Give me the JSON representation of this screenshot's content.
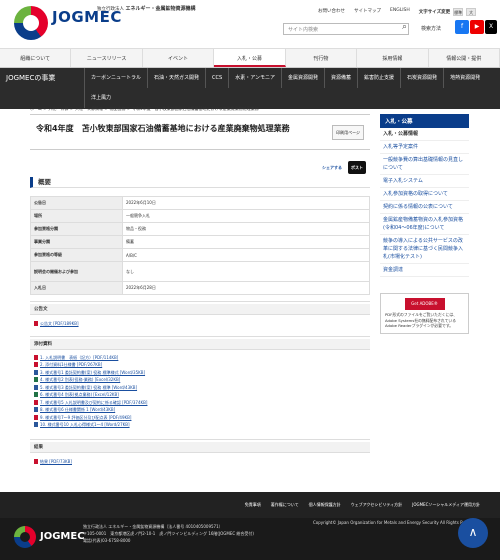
{
  "header": {
    "logo_text": "JOGMEC",
    "org_line1": "独立行政法人",
    "org_line2": "エネルギー・金属鉱物資源機構",
    "links": [
      "お問い合わせ",
      "サイトマップ",
      "ENGLISH"
    ],
    "fontsize_label": "文字サイズ変更",
    "fontsize_options": [
      "標準",
      "大"
    ],
    "search_placeholder": "サイト内検索",
    "color_label": "検索方法",
    "sns": [
      "f",
      "▶",
      "X"
    ]
  },
  "gnav": [
    "組織について",
    "ニュースリリース",
    "イベント",
    "入札・公募",
    "刊行物",
    "採用情報",
    "情報公開・提供"
  ],
  "subnav": {
    "title": "JOGMECの事業",
    "items": [
      "カーボンニュートラル",
      "石油・天然ガス開発",
      "CCS",
      "水素・アンモニア",
      "金属資源開発",
      "資源備蓄",
      "鉱害防止支援",
      "石炭資源開発",
      "地熱資源開発",
      "洋上風力"
    ]
  },
  "breadcrumb": "ホーム ＞ 入札・公募 ＞ 入札・公募情報 ＞ 物品役務 ＞ 令和4年度　苫小牧東部国家石油備蓄基地における産業廃棄物処理業務",
  "page": {
    "title": "令和4年度　苫小牧東部国家石油備蓄基地における産業廃棄物処理業務",
    "print_label": "印刷用ページ",
    "share_label": "シェアする",
    "tweet_label": "ポスト",
    "overview_heading": "概要",
    "table": [
      [
        "公告日",
        "2022年6月10日"
      ],
      [
        "場所",
        "一般競争入札"
      ],
      [
        "参加資格分類",
        "物品・役務"
      ],
      [
        "事業分類",
        "備蓄"
      ],
      [
        "参加資格の等級",
        "A/B/C"
      ],
      [
        "説明会の開催および参加",
        "なし"
      ],
      [
        "入札日",
        "2022年6月28日"
      ]
    ],
    "notice_heading": "公告文",
    "notice_files": [
      "公告文 [PDF/189KB]"
    ],
    "attach_heading": "添付資料",
    "attach_files": [
      "1. 入札説明書　表紙（記方）[PDF/114KB]",
      "2. 添付資料1仕様書 [PDF/267KB]",
      "3. 様式番号1 委託契約書(案) 役務 標準様式 [Word/35KB]",
      "4. 様式番号2 別表(役務-業務) [Excel/32KB]",
      "5. 様式番号3 委託契約書(案) 役務 標準 [Word/43KB]",
      "6. 様式番号4 別表(拠点業務) [Excel/12KB]",
      "7. 様式番号5 入札説明書及び契約に係る確認 [PDF/374KB]",
      "8. 様式番号6 仕様書関係 1 [Word/43KB]",
      "9. 様式番号7〜9 評価区分及び配点表 [PDF/49KB]",
      "10. 様式番号10 入札心得様式1〜4 [Word/27KB]"
    ],
    "result_heading": "結果",
    "result_files": [
      "結果 [PDF/73KB]"
    ]
  },
  "side": {
    "heading": "入札・公募",
    "items": [
      "入札・公募情報",
      "入札等予定案件",
      "一般競争費の算出基礎情報の見直しについて",
      "電子入札システム",
      "入札参加資格の取得について",
      "契約に係る情報の公表について",
      "金属鉱産物備蓄物資の入札参加資格(令和04〜06年度)について",
      "競争の導入による公共サービスの改革に関する法律に基づく民間競争入札(市場化テスト)",
      "資金調達"
    ],
    "reader_button": "Get ADOBE® READER®",
    "reader_text": "PDF形式のファイルをご覧いただくには、Adobe Systems社の無料配布されているAdobe Readerプラグインが必要です。"
  },
  "footer": {
    "links": [
      "免責事項",
      "著作権について",
      "個人情報保護方針",
      "ウェブアクセシビリティ方針",
      "JOGMECソーシャルメディア運用方針"
    ],
    "logo_text": "JOGMEC",
    "address": [
      "独立行政法人 エネルギー・金属鉱物資源機構（法人番号 4010405009571）",
      "〒105-0001　東京都港区虎ノ門2-10-1　虎ノ門ツインビルディング 16階(JOGMEC 総合受付)",
      "電話(代表)03-6758-8000"
    ],
    "copyright": "Copyright© Japan Organization for Metals and Energy Security All Rights Reserved.",
    "totop": "∧"
  }
}
